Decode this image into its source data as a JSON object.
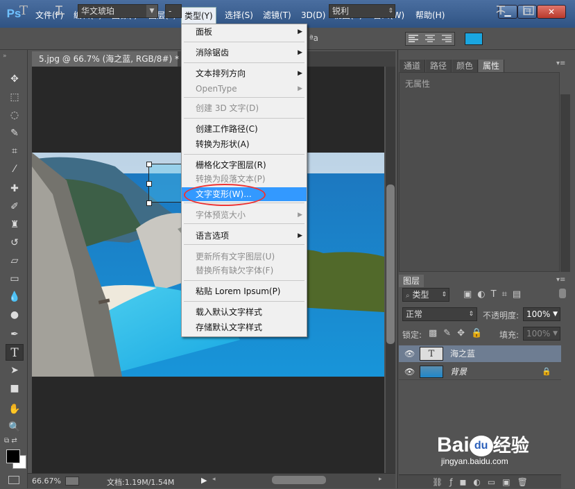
{
  "app": {
    "logo": "Ps"
  },
  "menubar": {
    "items": [
      "文件(F)",
      "编辑(E)",
      "图像(I)",
      "图层(L)",
      "类型(Y)",
      "选择(S)",
      "滤镜(T)",
      "3D(D)",
      "视图(V)",
      "窗口(W)",
      "帮助(H)"
    ],
    "active_index": 4,
    "window_buttons": {
      "minimize": "▁",
      "maximize": "☐",
      "close": "✕"
    }
  },
  "options_bar": {
    "font_family": "华文琥珀",
    "font_style": "-",
    "aa_label": "ªa",
    "antialias": "锐利",
    "text_color": "#1aa6e0"
  },
  "document": {
    "tab_title": "5.jpg @ 66.7% (海之蓝, RGB/8#) *",
    "close": "×",
    "zoom": "66.67%",
    "doc_size": "文档:1.19M/1.54M"
  },
  "type_menu": {
    "items": [
      {
        "label": "面板",
        "submenu": true,
        "disabled": false
      },
      {
        "label": "消除锯齿",
        "submenu": true,
        "disabled": false
      },
      {
        "label": "文本排列方向",
        "submenu": true,
        "disabled": false
      },
      {
        "label": "OpenType",
        "submenu": true,
        "disabled": true
      },
      {
        "label": "创建 3D 文字(D)",
        "submenu": false,
        "disabled": true
      },
      {
        "label": "创建工作路径(C)",
        "submenu": false,
        "disabled": false
      },
      {
        "label": "转换为形状(A)",
        "submenu": false,
        "disabled": false
      },
      {
        "label": "栅格化文字图层(R)",
        "submenu": false,
        "disabled": false
      },
      {
        "label": "转换为段落文本(P)",
        "submenu": false,
        "disabled": true
      },
      {
        "label": "文字变形(W)...",
        "submenu": false,
        "disabled": false,
        "highlighted": true
      },
      {
        "label": "字体预览大小",
        "submenu": true,
        "disabled": true
      },
      {
        "label": "语言选项",
        "submenu": true,
        "disabled": false
      },
      {
        "label": "更新所有文字图层(U)",
        "submenu": false,
        "disabled": true
      },
      {
        "label": "替换所有缺欠字体(F)",
        "submenu": false,
        "disabled": true
      },
      {
        "label": "粘贴 Lorem Ipsum(P)",
        "submenu": false,
        "disabled": false
      },
      {
        "label": "载入默认文字样式",
        "submenu": false,
        "disabled": false
      },
      {
        "label": "存储默认文字样式",
        "submenu": false,
        "disabled": false
      }
    ]
  },
  "properties_panel": {
    "tabs": [
      "通道",
      "路径",
      "颜色",
      "属性"
    ],
    "active_tab": 3,
    "empty_text": "无属性"
  },
  "layers_panel": {
    "tab": "图层",
    "filter_label": "类型",
    "blend_mode": "正常",
    "opacity_label": "不透明度:",
    "opacity_value": "100%",
    "lock_label": "锁定:",
    "fill_label": "填充:",
    "fill_value": "100%",
    "layers": [
      {
        "name": "海之蓝",
        "kind": "text",
        "thumb": "T",
        "selected": true
      },
      {
        "name": "背景",
        "kind": "image",
        "selected": false,
        "locked": true
      }
    ]
  },
  "watermark": {
    "brand": "Bai",
    "brand_du": "du",
    "brand_cn": "经验",
    "url": "jingyan.baidu.com"
  }
}
